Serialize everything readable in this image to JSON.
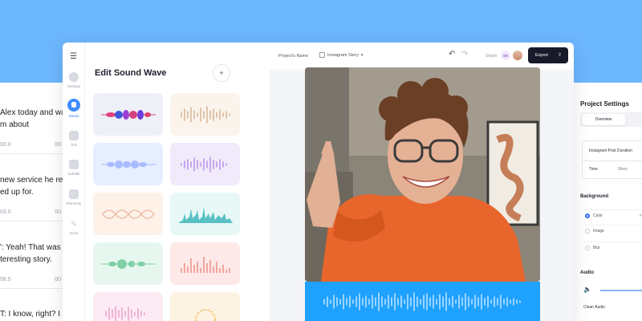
{
  "transcript": [
    {
      "line1": "Alex today and wa",
      "line2": "m about",
      "time_start": "00.0",
      "time_end": "00"
    },
    {
      "line1": "new service he rec",
      "line2": "ed up for.",
      "time_start": "03.0",
      "time_end": "00"
    },
    {
      "line1": "': Yeah! That was kin",
      "line2": "teresting story.",
      "time_start": "08.5",
      "time_end": "00"
    },
    {
      "line1": "T: I know, right? I k",
      "line2": "",
      "time_start": "",
      "time_end": ""
    }
  ],
  "rail": {
    "items": [
      {
        "label": "Settings",
        "icon": "gear-icon"
      },
      {
        "label": "Media",
        "icon": "media-icon"
      },
      {
        "label": "Text",
        "icon": "text-icon"
      },
      {
        "label": "Subtitle",
        "icon": "subtitle-icon"
      },
      {
        "label": "Elements",
        "icon": "elements-icon"
      },
      {
        "label": "Draw",
        "icon": "pen-icon"
      }
    ]
  },
  "panel": {
    "title": "Edit Sound Wave",
    "add_label": "+",
    "tiles": [
      {
        "style": "multicolor-bars",
        "bg": "#eef0f7"
      },
      {
        "style": "tan-bars",
        "bg": "#fbf4ec"
      },
      {
        "style": "blue-blobs",
        "bg": "#e6eeff"
      },
      {
        "style": "purple-bars",
        "bg": "#f1eafb"
      },
      {
        "style": "orange-lines",
        "bg": "#fdf1e8"
      },
      {
        "style": "teal-spikes",
        "bg": "#e8f8f7"
      },
      {
        "style": "green-blobs",
        "bg": "#e7f7ef"
      },
      {
        "style": "red-spikes",
        "bg": "#fde9e7"
      },
      {
        "style": "pink-bars",
        "bg": "#fcebf5"
      },
      {
        "style": "circle-wave",
        "bg": "#fdf3e3"
      }
    ]
  },
  "topbar": {
    "project_name": "Project's Name",
    "story_label": "Instagram Story",
    "undo": "↶",
    "redo": "↷",
    "share": "Share",
    "user_initials": "SK",
    "export": "Export",
    "export_icon": "⇪"
  },
  "settings": {
    "title": "Project Settings",
    "tab_overview": "Overview",
    "duration_label": "Instagram Post Duration",
    "time_label": "Time",
    "time_value": "Shoo",
    "background_title": "Background",
    "bg_options": [
      {
        "label": "Color",
        "value": "#f",
        "selected": true
      },
      {
        "label": "Image",
        "value": "",
        "selected": false
      },
      {
        "label": "Blur",
        "value": "",
        "selected": false
      }
    ],
    "audio_title": "Audio",
    "clean_audio": "Clean Audio"
  },
  "colors": {
    "background": "#6db7ff",
    "accent": "#3f8cff",
    "wave_bar": "#1ea1ff",
    "export_bg": "#171a2a"
  }
}
